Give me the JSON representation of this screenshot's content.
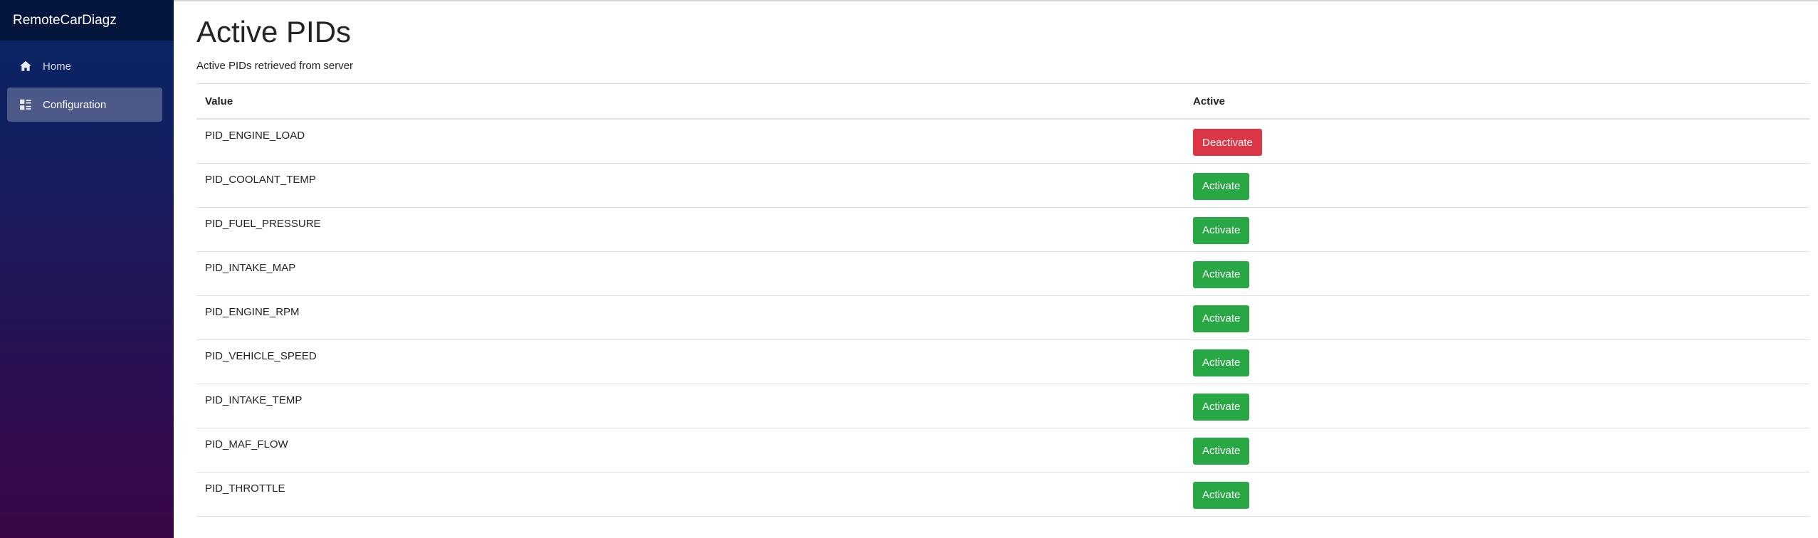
{
  "app": {
    "brand": "RemoteCarDiagz"
  },
  "sidebar": {
    "items": [
      {
        "label": "Home",
        "icon": "home-icon",
        "active": false
      },
      {
        "label": "Configuration",
        "icon": "configuration-icon",
        "active": true
      }
    ]
  },
  "page": {
    "title": "Active PIDs",
    "subtitle": "Active PIDs retrieved from server"
  },
  "table": {
    "headers": {
      "value": "Value",
      "active": "Active"
    },
    "rows": [
      {
        "value": "PID_ENGINE_LOAD",
        "action": "Deactivate",
        "action_style": "danger"
      },
      {
        "value": "PID_COOLANT_TEMP",
        "action": "Activate",
        "action_style": "success"
      },
      {
        "value": "PID_FUEL_PRESSURE",
        "action": "Activate",
        "action_style": "success"
      },
      {
        "value": "PID_INTAKE_MAP",
        "action": "Activate",
        "action_style": "success"
      },
      {
        "value": "PID_ENGINE_RPM",
        "action": "Activate",
        "action_style": "success"
      },
      {
        "value": "PID_VEHICLE_SPEED",
        "action": "Activate",
        "action_style": "success"
      },
      {
        "value": "PID_INTAKE_TEMP",
        "action": "Activate",
        "action_style": "success"
      },
      {
        "value": "PID_MAF_FLOW",
        "action": "Activate",
        "action_style": "success"
      },
      {
        "value": "PID_THROTTLE",
        "action": "Activate",
        "action_style": "success"
      }
    ]
  },
  "colors": {
    "success": "#28a745",
    "danger": "#dc3545",
    "sidebar_top": "#052767",
    "sidebar_bottom": "#3a0647"
  }
}
